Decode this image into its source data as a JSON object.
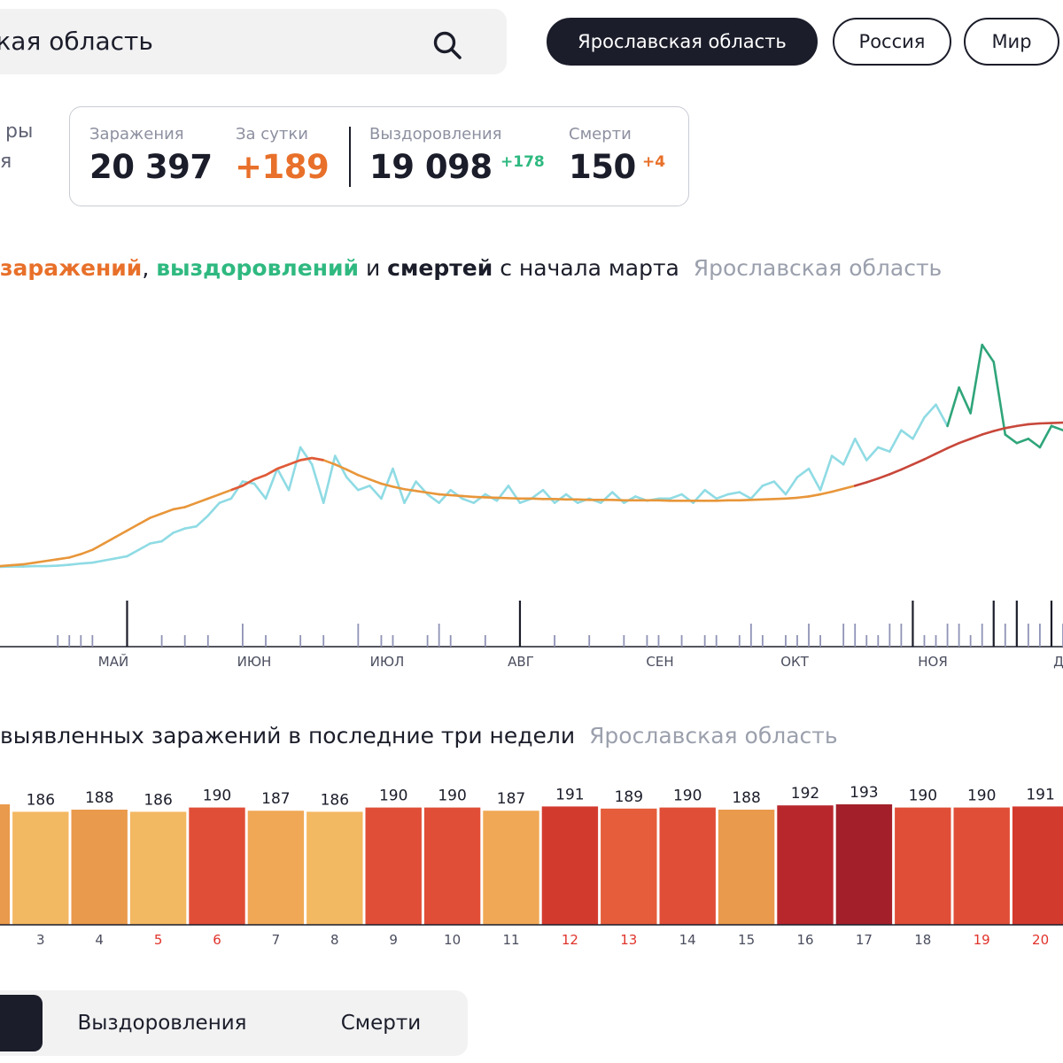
{
  "search": {
    "value": "ская область"
  },
  "region_pills": [
    {
      "label": "Ярославская область",
      "active": true
    },
    {
      "label": "Россия",
      "active": false
    },
    {
      "label": "Мир",
      "active": false
    }
  ],
  "side_text": {
    "line1": "ры",
    "line2": "я"
  },
  "stats": {
    "infections": {
      "label": "Заражения",
      "value": "20 397"
    },
    "daily": {
      "label": "За сутки",
      "value": "+189"
    },
    "recoveries": {
      "label": "Выздоровления",
      "value": "19 098",
      "delta": "+178"
    },
    "deaths": {
      "label": "Смерти",
      "value": "150",
      "delta": "+4"
    }
  },
  "chart_title": {
    "w_inf": "заражений",
    "comma": ", ",
    "w_rec": "выздоровлений",
    "and": " и ",
    "w_dea": "смертей",
    "rest": " с начала марта",
    "region": "Ярославская область"
  },
  "heatmap_title": {
    "text": "выявленных заражений в последние три недели",
    "region": "Ярославская область"
  },
  "tabs": [
    {
      "label": "",
      "active": true
    },
    {
      "label": "Выздоровления",
      "active": false
    },
    {
      "label": "Смерти",
      "active": false
    }
  ],
  "colors": {
    "infections_line": "#e8963a",
    "infections_line_dark": "#c8473a",
    "recoveries_line": "#8fdbe4",
    "recoveries_line_dark": "#2fa57a",
    "deaths_bars": "#8f93b6",
    "dark": "#1b1d2a",
    "weekend_red": "#e0332a"
  },
  "chart_data": [
    {
      "type": "line",
      "x_months": [
        "МАЙ",
        "ИЮН",
        "ИЮЛ",
        "АВГ",
        "СЕН",
        "ОКТ",
        "НОЯ",
        "Д"
      ],
      "series": [
        {
          "values": [
            2,
            4,
            6,
            10,
            14,
            18,
            22,
            30,
            40,
            55,
            70,
            85,
            100,
            115,
            125,
            135,
            140,
            150,
            160,
            170,
            180,
            190,
            205,
            215,
            230,
            240,
            250,
            255,
            250,
            240,
            228,
            215,
            205,
            195,
            188,
            182,
            178,
            174,
            170,
            168,
            166,
            164,
            163,
            162,
            161,
            160,
            160,
            159,
            159,
            158,
            158,
            157,
            157,
            157,
            156,
            156,
            156,
            156,
            155,
            155,
            155,
            155,
            155,
            156,
            156,
            157,
            158,
            159,
            160,
            162,
            165,
            170,
            176,
            183,
            190,
            198,
            207,
            217,
            228,
            240,
            252,
            265,
            278,
            290,
            300,
            310,
            318,
            325,
            330,
            334,
            336,
            337,
            338
          ]
        },
        {
          "values": [
            0,
            1,
            1,
            2,
            2,
            3,
            5,
            8,
            10,
            15,
            20,
            25,
            40,
            55,
            60,
            80,
            90,
            95,
            120,
            150,
            160,
            200,
            195,
            160,
            230,
            180,
            280,
            240,
            150,
            260,
            210,
            180,
            190,
            160,
            230,
            150,
            200,
            170,
            150,
            180,
            160,
            150,
            170,
            155,
            190,
            150,
            160,
            180,
            150,
            170,
            150,
            160,
            150,
            175,
            150,
            165,
            155,
            160,
            160,
            170,
            150,
            180,
            160,
            170,
            175,
            160,
            190,
            200,
            170,
            210,
            230,
            180,
            260,
            240,
            300,
            250,
            280,
            270,
            320,
            300,
            350,
            380,
            330,
            420,
            360,
            520,
            480,
            310,
            290,
            300,
            280,
            330,
            320
          ]
        },
        {
          "values": [
            0,
            0,
            0,
            0,
            0,
            1,
            1,
            1,
            1,
            0,
            0,
            3,
            0,
            0,
            1,
            0,
            1,
            0,
            1,
            0,
            0,
            2,
            0,
            1,
            0,
            0,
            1,
            0,
            1,
            0,
            0,
            2,
            0,
            1,
            1,
            0,
            0,
            1,
            2,
            1,
            0,
            0,
            1,
            0,
            0,
            3,
            0,
            0,
            1,
            0,
            0,
            1,
            0,
            0,
            1,
            0,
            1,
            1,
            0,
            1,
            0,
            1,
            1,
            0,
            1,
            2,
            1,
            0,
            1,
            1,
            2,
            1,
            0,
            2,
            2,
            1,
            1,
            2,
            2,
            3,
            1,
            1,
            2,
            2,
            1,
            2,
            3,
            2,
            3,
            2,
            2,
            3,
            2
          ]
        }
      ]
    },
    {
      "type": "heatmap",
      "categories": [
        "",
        "3",
        "4",
        "5",
        "6",
        "7",
        "8",
        "9",
        "10",
        "11",
        "12",
        "13",
        "14",
        "15",
        "16",
        "17",
        "18",
        "19",
        "20",
        ""
      ],
      "values": [
        null,
        186,
        188,
        186,
        190,
        187,
        186,
        190,
        190,
        187,
        191,
        189,
        190,
        188,
        192,
        193,
        190,
        190,
        191,
        null
      ],
      "red_days": [
        "5",
        "6",
        "12",
        "13",
        "19",
        "20"
      ]
    }
  ]
}
